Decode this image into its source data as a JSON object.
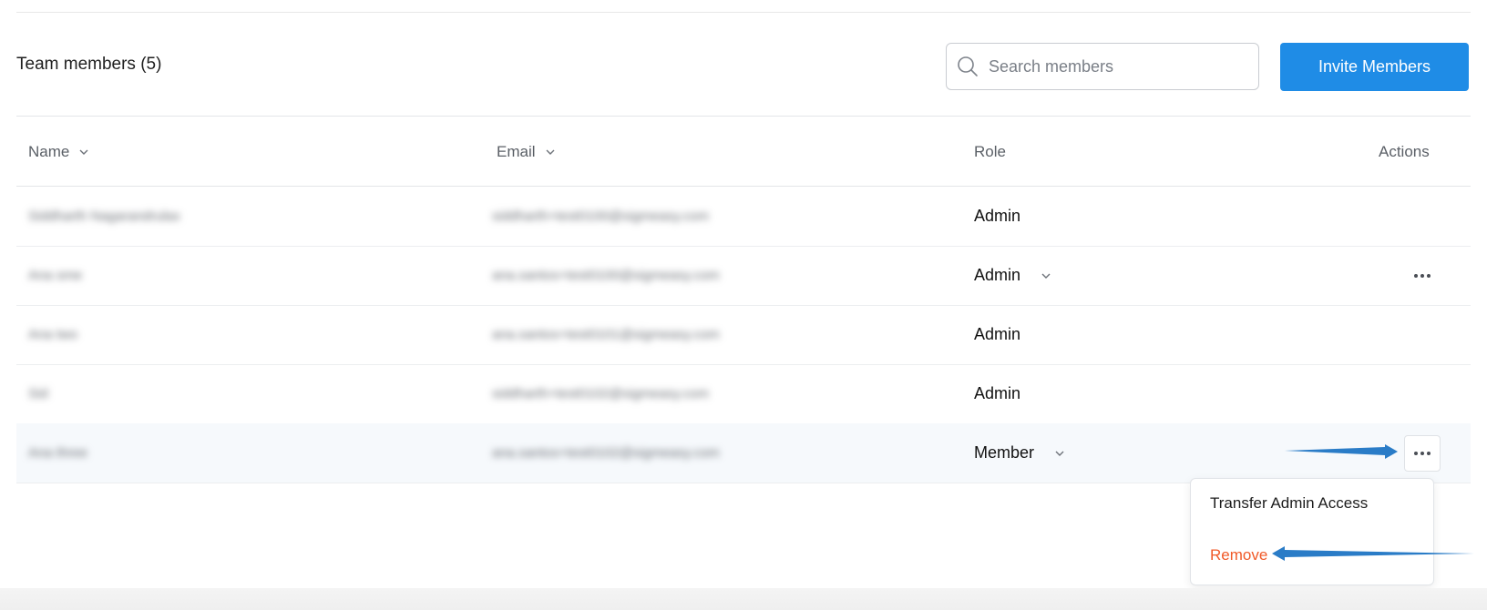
{
  "header": {
    "title": "Team members (5)"
  },
  "search": {
    "placeholder": "Search members",
    "value": ""
  },
  "invite_button": {
    "label": "Invite Members"
  },
  "table": {
    "columns": [
      {
        "label": "Name",
        "sortable": true
      },
      {
        "label": "Email",
        "sortable": true
      },
      {
        "label": "Role",
        "sortable": false
      },
      {
        "label": "Actions",
        "sortable": false
      }
    ],
    "rows": [
      {
        "name": "Siddharth Nagarandrulax",
        "email": "siddharth+test0100@sigmeasy.com",
        "role": "Admin",
        "has_role_dropdown": false,
        "has_actions": false
      },
      {
        "name": "Ana sme",
        "email": "ana.santos+test0100@sigmeasy.com",
        "role": "Admin",
        "has_role_dropdown": true,
        "has_actions": true
      },
      {
        "name": "Ana two",
        "email": "ana.santos+test0101@sigmeasy.com",
        "role": "Admin",
        "has_role_dropdown": false,
        "has_actions": false
      },
      {
        "name": "Sid",
        "email": "siddharth+test0102@sigmeasy.com",
        "role": "Admin",
        "has_role_dropdown": false,
        "has_actions": false
      },
      {
        "name": "Ana three",
        "email": "ana.santos+test0102@sigmeasy.com",
        "role": "Member",
        "has_role_dropdown": true,
        "has_actions": true,
        "highlighted": true
      }
    ]
  },
  "actions_menu": {
    "items": [
      {
        "label": "Transfer Admin Access",
        "color": "#1d1d1d"
      },
      {
        "label": "Remove",
        "color": "#f05a28"
      }
    ]
  },
  "colors": {
    "accent": "#1f8ce6",
    "danger": "#f05a28",
    "annotation_arrow": "#2a7cc7"
  },
  "icons": {
    "search": "search-icon",
    "sort": "chevron-down-icon",
    "more": "more-horizontal-icon"
  }
}
